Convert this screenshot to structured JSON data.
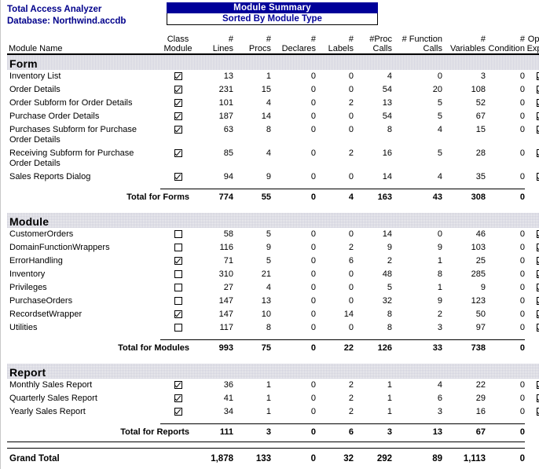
{
  "header": {
    "app_name": "Total Access Analyzer",
    "database_line": "Database: Northwind.accdb",
    "report_title": "Module Summary",
    "report_subtitle": "Sorted By Module Type",
    "banner_bg": "#000099",
    "banner_fg": "#ffffff",
    "ident_color": "#00008b"
  },
  "columns": [
    {
      "key": "name",
      "label": "Module Name"
    },
    {
      "key": "class",
      "label": "Class\nModule"
    },
    {
      "key": "lines",
      "label": "#\nLines"
    },
    {
      "key": "procs",
      "label": "#\nProcs"
    },
    {
      "key": "declares",
      "label": "#\nDeclares"
    },
    {
      "key": "labels",
      "label": "#\nLabels"
    },
    {
      "key": "proccalls",
      "label": "#Proc\nCalls"
    },
    {
      "key": "funccalls",
      "label": "# Function\nCalls"
    },
    {
      "key": "variables",
      "label": "#\nVariables"
    },
    {
      "key": "condition",
      "label": "#\nCondition"
    },
    {
      "key": "explicit",
      "label": "Option\nExplicit"
    }
  ],
  "sections": [
    {
      "title": "Form",
      "rows": [
        {
          "name": "Inventory List",
          "class": true,
          "lines": "13",
          "procs": "1",
          "declares": "0",
          "labels": "0",
          "proccalls": "4",
          "funccalls": "0",
          "variables": "3",
          "condition": "0",
          "explicit": true
        },
        {
          "name": "Order Details",
          "class": true,
          "lines": "231",
          "procs": "15",
          "declares": "0",
          "labels": "0",
          "proccalls": "54",
          "funccalls": "20",
          "variables": "108",
          "condition": "0",
          "explicit": true
        },
        {
          "name": "Order Subform for Order Details",
          "class": true,
          "lines": "101",
          "procs": "4",
          "declares": "0",
          "labels": "2",
          "proccalls": "13",
          "funccalls": "5",
          "variables": "52",
          "condition": "0",
          "explicit": true
        },
        {
          "name": "Purchase Order Details",
          "class": true,
          "lines": "187",
          "procs": "14",
          "declares": "0",
          "labels": "0",
          "proccalls": "54",
          "funccalls": "5",
          "variables": "67",
          "condition": "0",
          "explicit": true
        },
        {
          "name": "Purchases Subform for Purchase Order Details",
          "class": true,
          "lines": "63",
          "procs": "8",
          "declares": "0",
          "labels": "0",
          "proccalls": "8",
          "funccalls": "4",
          "variables": "15",
          "condition": "0",
          "explicit": true
        },
        {
          "name": "Receiving Subform  for Purchase Order Details",
          "class": true,
          "lines": "85",
          "procs": "4",
          "declares": "0",
          "labels": "2",
          "proccalls": "16",
          "funccalls": "5",
          "variables": "28",
          "condition": "0",
          "explicit": true
        },
        {
          "name": "Sales Reports Dialog",
          "class": true,
          "lines": "94",
          "procs": "9",
          "declares": "0",
          "labels": "0",
          "proccalls": "14",
          "funccalls": "4",
          "variables": "35",
          "condition": "0",
          "explicit": true
        }
      ],
      "total": {
        "label": "Total for Forms",
        "lines": "774",
        "procs": "55",
        "declares": "0",
        "labels": "4",
        "proccalls": "163",
        "funccalls": "43",
        "variables": "308",
        "condition": "0"
      }
    },
    {
      "title": "Module",
      "rows": [
        {
          "name": "CustomerOrders",
          "class": false,
          "lines": "58",
          "procs": "5",
          "declares": "0",
          "labels": "0",
          "proccalls": "14",
          "funccalls": "0",
          "variables": "46",
          "condition": "0",
          "explicit": true
        },
        {
          "name": "DomainFunctionWrappers",
          "class": false,
          "lines": "116",
          "procs": "9",
          "declares": "0",
          "labels": "2",
          "proccalls": "9",
          "funccalls": "9",
          "variables": "103",
          "condition": "0",
          "explicit": true
        },
        {
          "name": "ErrorHandling",
          "class": true,
          "lines": "71",
          "procs": "5",
          "declares": "0",
          "labels": "6",
          "proccalls": "2",
          "funccalls": "1",
          "variables": "25",
          "condition": "0",
          "explicit": true
        },
        {
          "name": "Inventory",
          "class": false,
          "lines": "310",
          "procs": "21",
          "declares": "0",
          "labels": "0",
          "proccalls": "48",
          "funccalls": "8",
          "variables": "285",
          "condition": "0",
          "explicit": true
        },
        {
          "name": "Privileges",
          "class": false,
          "lines": "27",
          "procs": "4",
          "declares": "0",
          "labels": "0",
          "proccalls": "5",
          "funccalls": "1",
          "variables": "9",
          "condition": "0",
          "explicit": true
        },
        {
          "name": "PurchaseOrders",
          "class": false,
          "lines": "147",
          "procs": "13",
          "declares": "0",
          "labels": "0",
          "proccalls": "32",
          "funccalls": "9",
          "variables": "123",
          "condition": "0",
          "explicit": true
        },
        {
          "name": "RecordsetWrapper",
          "class": true,
          "lines": "147",
          "procs": "10",
          "declares": "0",
          "labels": "14",
          "proccalls": "8",
          "funccalls": "2",
          "variables": "50",
          "condition": "0",
          "explicit": true
        },
        {
          "name": "Utilities",
          "class": false,
          "lines": "117",
          "procs": "8",
          "declares": "0",
          "labels": "0",
          "proccalls": "8",
          "funccalls": "3",
          "variables": "97",
          "condition": "0",
          "explicit": true
        }
      ],
      "total": {
        "label": "Total for Modules",
        "lines": "993",
        "procs": "75",
        "declares": "0",
        "labels": "22",
        "proccalls": "126",
        "funccalls": "33",
        "variables": "738",
        "condition": "0"
      }
    },
    {
      "title": "Report",
      "rows": [
        {
          "name": "Monthly Sales Report",
          "class": true,
          "lines": "36",
          "procs": "1",
          "declares": "0",
          "labels": "2",
          "proccalls": "1",
          "funccalls": "4",
          "variables": "22",
          "condition": "0",
          "explicit": true
        },
        {
          "name": "Quarterly Sales Report",
          "class": true,
          "lines": "41",
          "procs": "1",
          "declares": "0",
          "labels": "2",
          "proccalls": "1",
          "funccalls": "6",
          "variables": "29",
          "condition": "0",
          "explicit": true
        },
        {
          "name": "Yearly Sales Report",
          "class": true,
          "lines": "34",
          "procs": "1",
          "declares": "0",
          "labels": "2",
          "proccalls": "1",
          "funccalls": "3",
          "variables": "16",
          "condition": "0",
          "explicit": true
        }
      ],
      "total": {
        "label": "Total for Reports",
        "lines": "111",
        "procs": "3",
        "declares": "0",
        "labels": "6",
        "proccalls": "3",
        "funccalls": "13",
        "variables": "67",
        "condition": "0"
      }
    }
  ],
  "grand_total": {
    "label": "Grand Total",
    "lines": "1,878",
    "procs": "133",
    "declares": "0",
    "labels": "32",
    "proccalls": "292",
    "funccalls": "89",
    "variables": "1,113",
    "condition": "0"
  }
}
